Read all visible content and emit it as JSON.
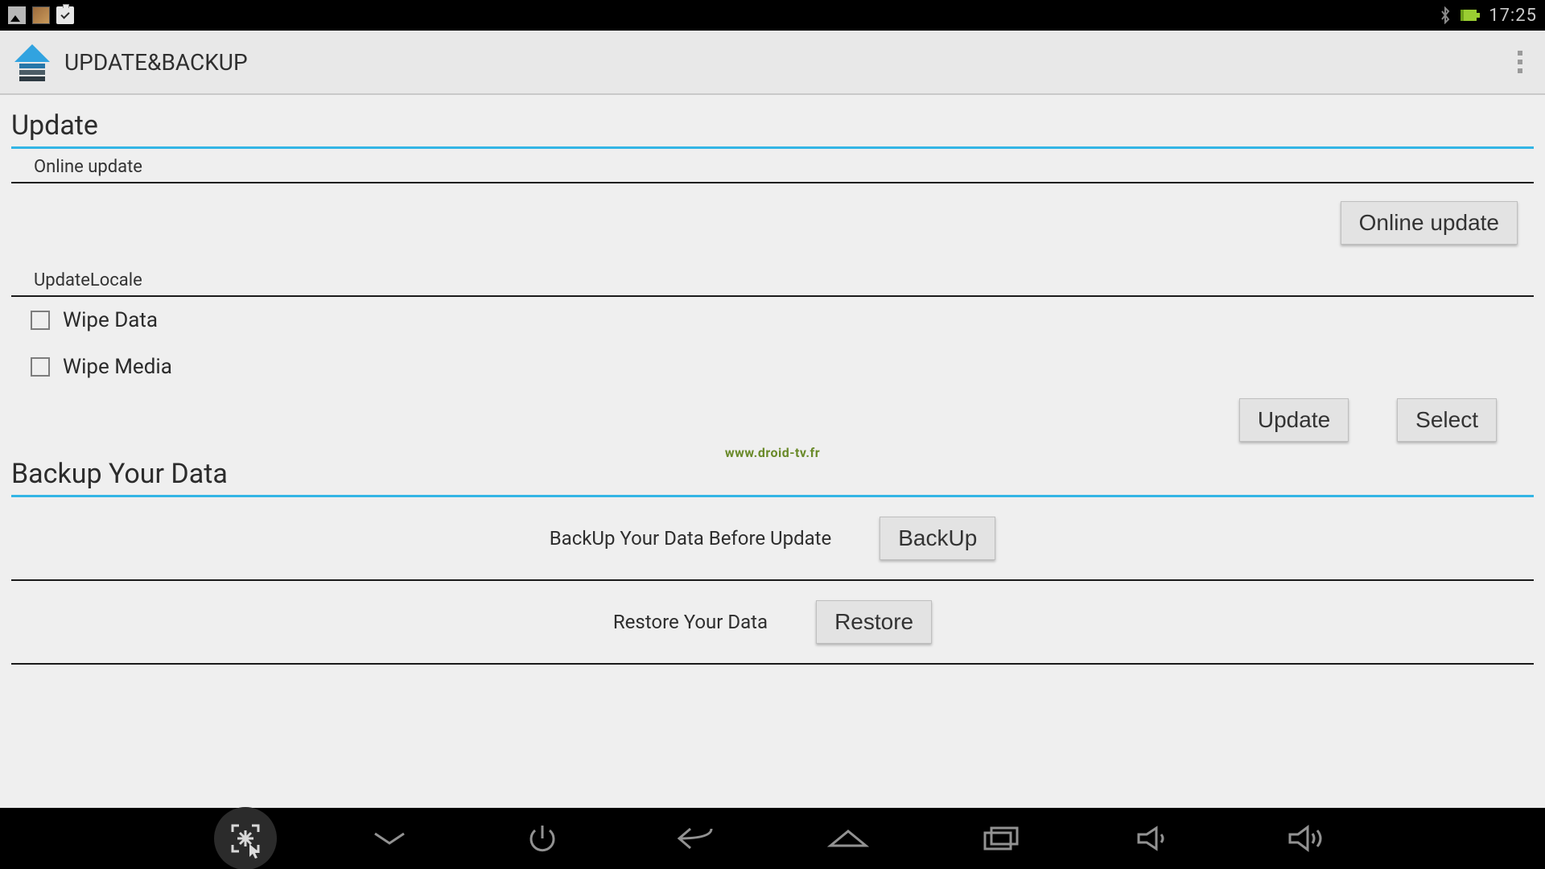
{
  "status": {
    "time": "17:25"
  },
  "actionbar": {
    "title": "UPDATE&BACKUP"
  },
  "update": {
    "heading": "Update",
    "online_header": "Online update",
    "online_button": "Online update",
    "locale_header": "UpdateLocale",
    "wipe_data_label": "Wipe Data",
    "wipe_media_label": "Wipe Media",
    "update_button": "Update",
    "select_button": "Select"
  },
  "backup": {
    "heading": "Backup Your Data",
    "backup_desc": "BackUp Your Data Before Update",
    "backup_button": "BackUp",
    "restore_desc": "Restore Your Data",
    "restore_button": "Restore"
  },
  "watermark": "www.droid-tv.fr"
}
